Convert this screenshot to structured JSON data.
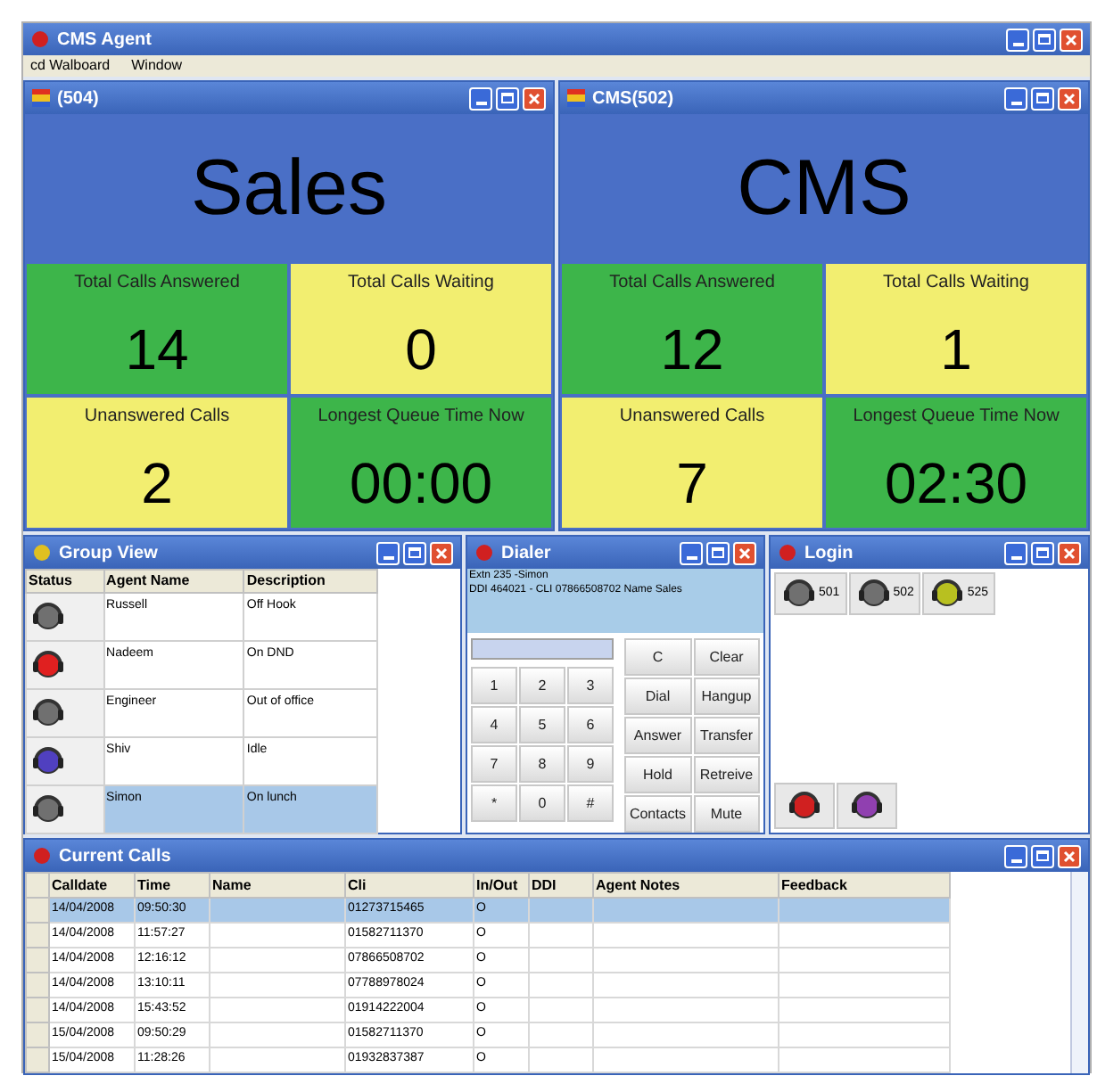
{
  "window": {
    "title": "CMS Agent"
  },
  "menu": [
    "cd Walboard",
    "Window"
  ],
  "wallboards": [
    {
      "title": "(504)",
      "name": "Sales",
      "tiles": [
        {
          "label": "Total Calls Answered",
          "value": "14",
          "color": "#3db54a"
        },
        {
          "label": "Total Calls Waiting",
          "value": "0",
          "color": "#f2ee70"
        },
        {
          "label": "Unanswered Calls",
          "value": "2",
          "color": "#f2ee70"
        },
        {
          "label": "Longest Queue Time Now",
          "value": "00:00",
          "color": "#3db54a"
        }
      ]
    },
    {
      "title": "CMS(502)",
      "name": "CMS",
      "tiles": [
        {
          "label": "Total Calls Answered",
          "value": "12",
          "color": "#3db54a"
        },
        {
          "label": "Total Calls Waiting",
          "value": "1",
          "color": "#f2ee70"
        },
        {
          "label": "Unanswered Calls",
          "value": "7",
          "color": "#f2ee70"
        },
        {
          "label": "Longest Queue Time Now",
          "value": "02:30",
          "color": "#3db54a"
        }
      ]
    }
  ],
  "group_view": {
    "title": "Group View",
    "columns": [
      "Status",
      "Agent Name",
      "Description"
    ],
    "rows": [
      {
        "color": "#707070",
        "agent": "Russell",
        "description": "Off Hook",
        "selected": false
      },
      {
        "color": "#e02020",
        "agent": "Nadeem",
        "description": "On DND",
        "selected": false
      },
      {
        "color": "#707070",
        "agent": "Engineer",
        "description": "Out of office",
        "selected": false
      },
      {
        "color": "#5040c0",
        "agent": "Shiv",
        "description": "Idle",
        "selected": false
      },
      {
        "color": "#707070",
        "agent": "Simon",
        "description": "On lunch",
        "selected": true
      }
    ]
  },
  "dialer": {
    "title": "Dialer",
    "info": [
      "Extn 235 -Simon",
      "DDI 464021 - CLI 07866508702 Name Sales"
    ],
    "keypad": [
      "1",
      "2",
      "3",
      "4",
      "5",
      "6",
      "7",
      "8",
      "9",
      "*",
      "0",
      "#"
    ],
    "actions": [
      "C",
      "Clear",
      "Dial",
      "Hangup",
      "Answer",
      "Transfer",
      "Hold",
      "Retreive",
      "Contacts",
      "Mute"
    ]
  },
  "login": {
    "title": "Login",
    "extensions": [
      {
        "label": "501",
        "color": "#707070"
      },
      {
        "label": "502",
        "color": "#707070"
      },
      {
        "label": "525",
        "color": "#b8c020"
      }
    ],
    "buttons": [
      {
        "color": "#d02020"
      },
      {
        "color": "#9040b0"
      }
    ]
  },
  "current_calls": {
    "title": "Current Calls",
    "columns": [
      "Calldate",
      "Time",
      "Name",
      "Cli",
      "In/Out",
      "DDI",
      "Agent Notes",
      "Feedback"
    ],
    "rows": [
      {
        "cells": [
          "14/04/2008",
          "09:50:30",
          "",
          "01273715465",
          "O",
          "",
          "",
          ""
        ],
        "selected": true
      },
      {
        "cells": [
          "14/04/2008",
          "11:57:27",
          "",
          "01582711370",
          "O",
          "",
          "",
          ""
        ],
        "selected": false
      },
      {
        "cells": [
          "14/04/2008",
          "12:16:12",
          "",
          "07866508702",
          "O",
          "",
          "",
          ""
        ],
        "selected": false
      },
      {
        "cells": [
          "14/04/2008",
          "13:10:11",
          "",
          "07788978024",
          "O",
          "",
          "",
          ""
        ],
        "selected": false
      },
      {
        "cells": [
          "14/04/2008",
          "15:43:52",
          "",
          "01914222004",
          "O",
          "",
          "",
          ""
        ],
        "selected": false
      },
      {
        "cells": [
          "15/04/2008",
          "09:50:29",
          "",
          "01582711370",
          "O",
          "",
          "",
          ""
        ],
        "selected": false
      },
      {
        "cells": [
          "15/04/2008",
          "11:28:26",
          "",
          "01932837387",
          "O",
          "",
          "",
          ""
        ],
        "selected": false
      }
    ]
  }
}
